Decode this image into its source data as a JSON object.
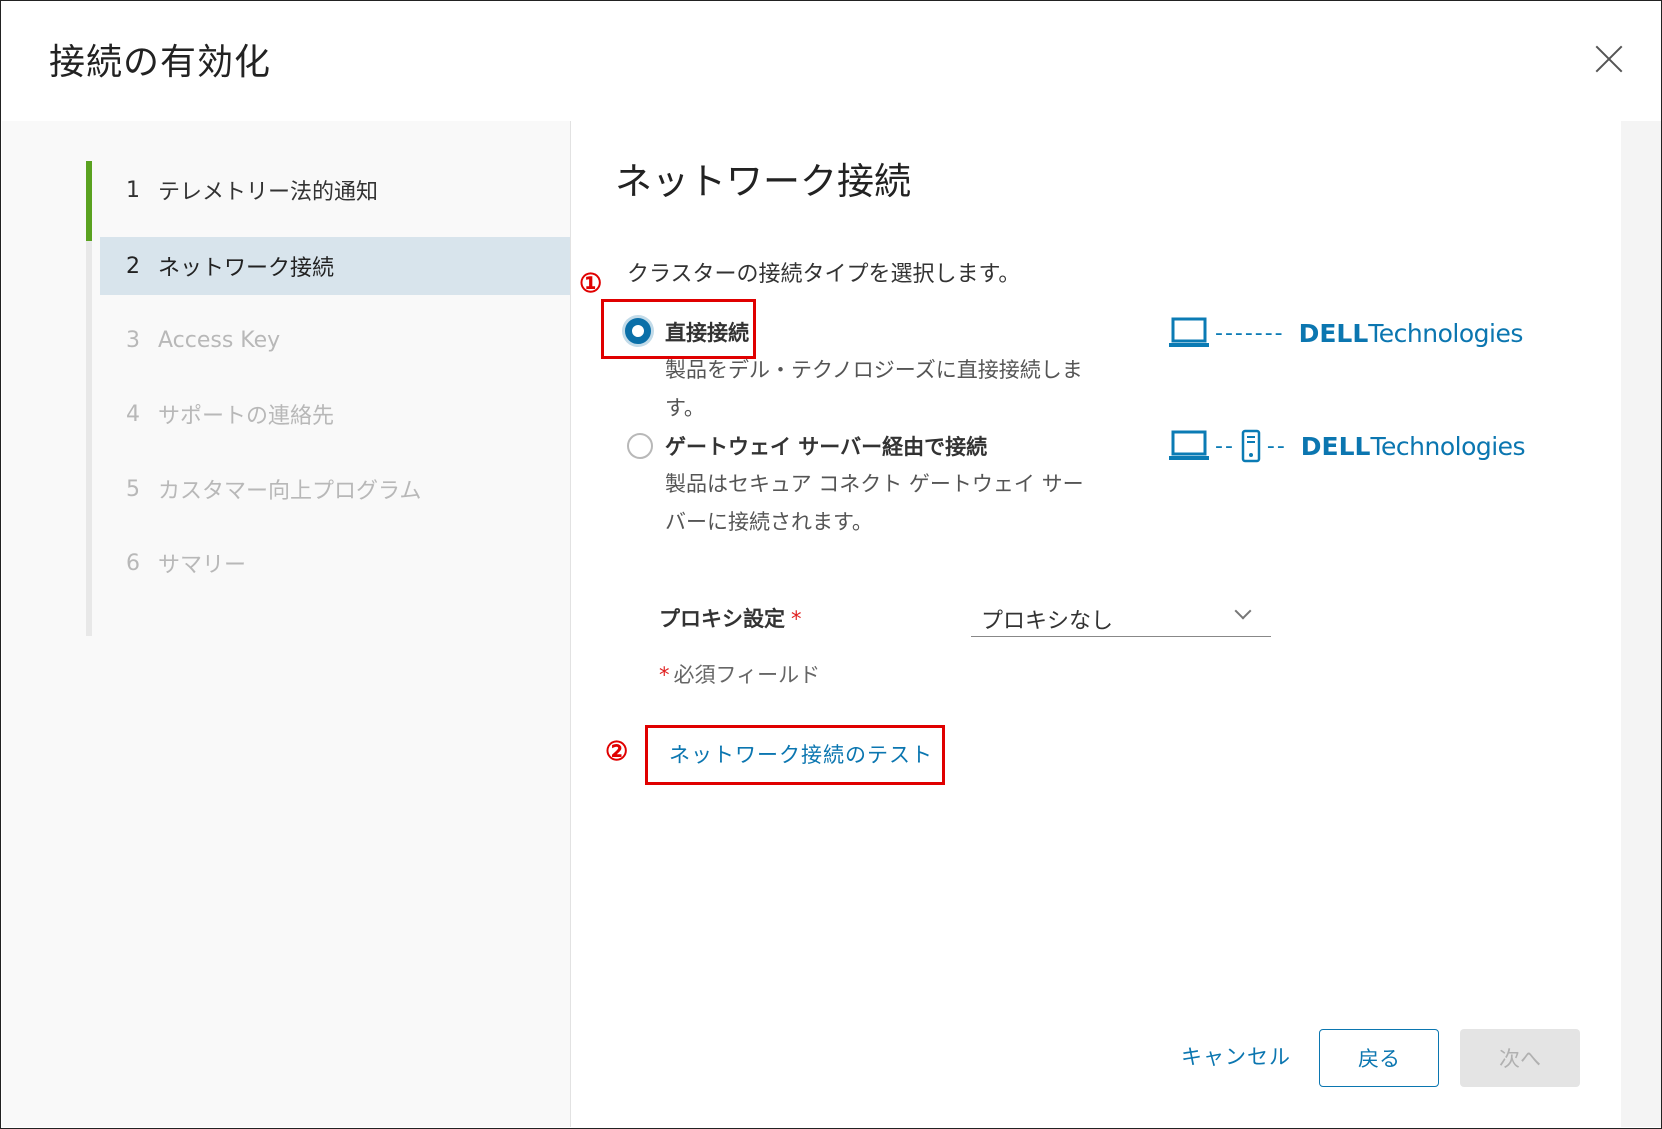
{
  "dialog": {
    "title": "接続の有効化"
  },
  "steps": [
    {
      "num": "1",
      "label": "テレメトリー法的通知",
      "state": "completed"
    },
    {
      "num": "2",
      "label": "ネットワーク接続",
      "state": "current"
    },
    {
      "num": "3",
      "label": "Access Key",
      "state": "disabled"
    },
    {
      "num": "4",
      "label": "サポートの連絡先",
      "state": "disabled"
    },
    {
      "num": "5",
      "label": "カスタマー向上プログラム",
      "state": "disabled"
    },
    {
      "num": "6",
      "label": "サマリー",
      "state": "disabled"
    }
  ],
  "main": {
    "title": "ネットワーク接続",
    "instruction": "クラスターの接続タイプを選択します。",
    "callouts": {
      "one": "①",
      "two": "②"
    },
    "options": [
      {
        "label": "直接接続",
        "desc_line1": "製品をデル・テクノロジーズに直接接続しま",
        "desc_line2": "す。",
        "checked": true,
        "diagram_dashes": "-------"
      },
      {
        "label": "ゲートウェイ サーバー経由で接続",
        "desc_line1": "製品はセキュア コネクト ゲートウェイ サー",
        "desc_line2": "バーに接続されます。",
        "checked": false,
        "diagram_dashes_left": "--",
        "diagram_dashes_right": "--"
      }
    ],
    "logo": {
      "brand": "DELL",
      "suffix": "Technologies"
    },
    "proxy": {
      "label": "プロキシ設定",
      "required_mark": "*",
      "value": "プロキシなし"
    },
    "required_note": "必須フィールド",
    "test_link": "ネットワーク接続のテスト"
  },
  "footer": {
    "cancel": "キャンセル",
    "back": "戻る",
    "next": "次へ"
  },
  "colors": {
    "accent": "#0b76b0",
    "complete": "#5aa220",
    "callout": "#e00000"
  }
}
